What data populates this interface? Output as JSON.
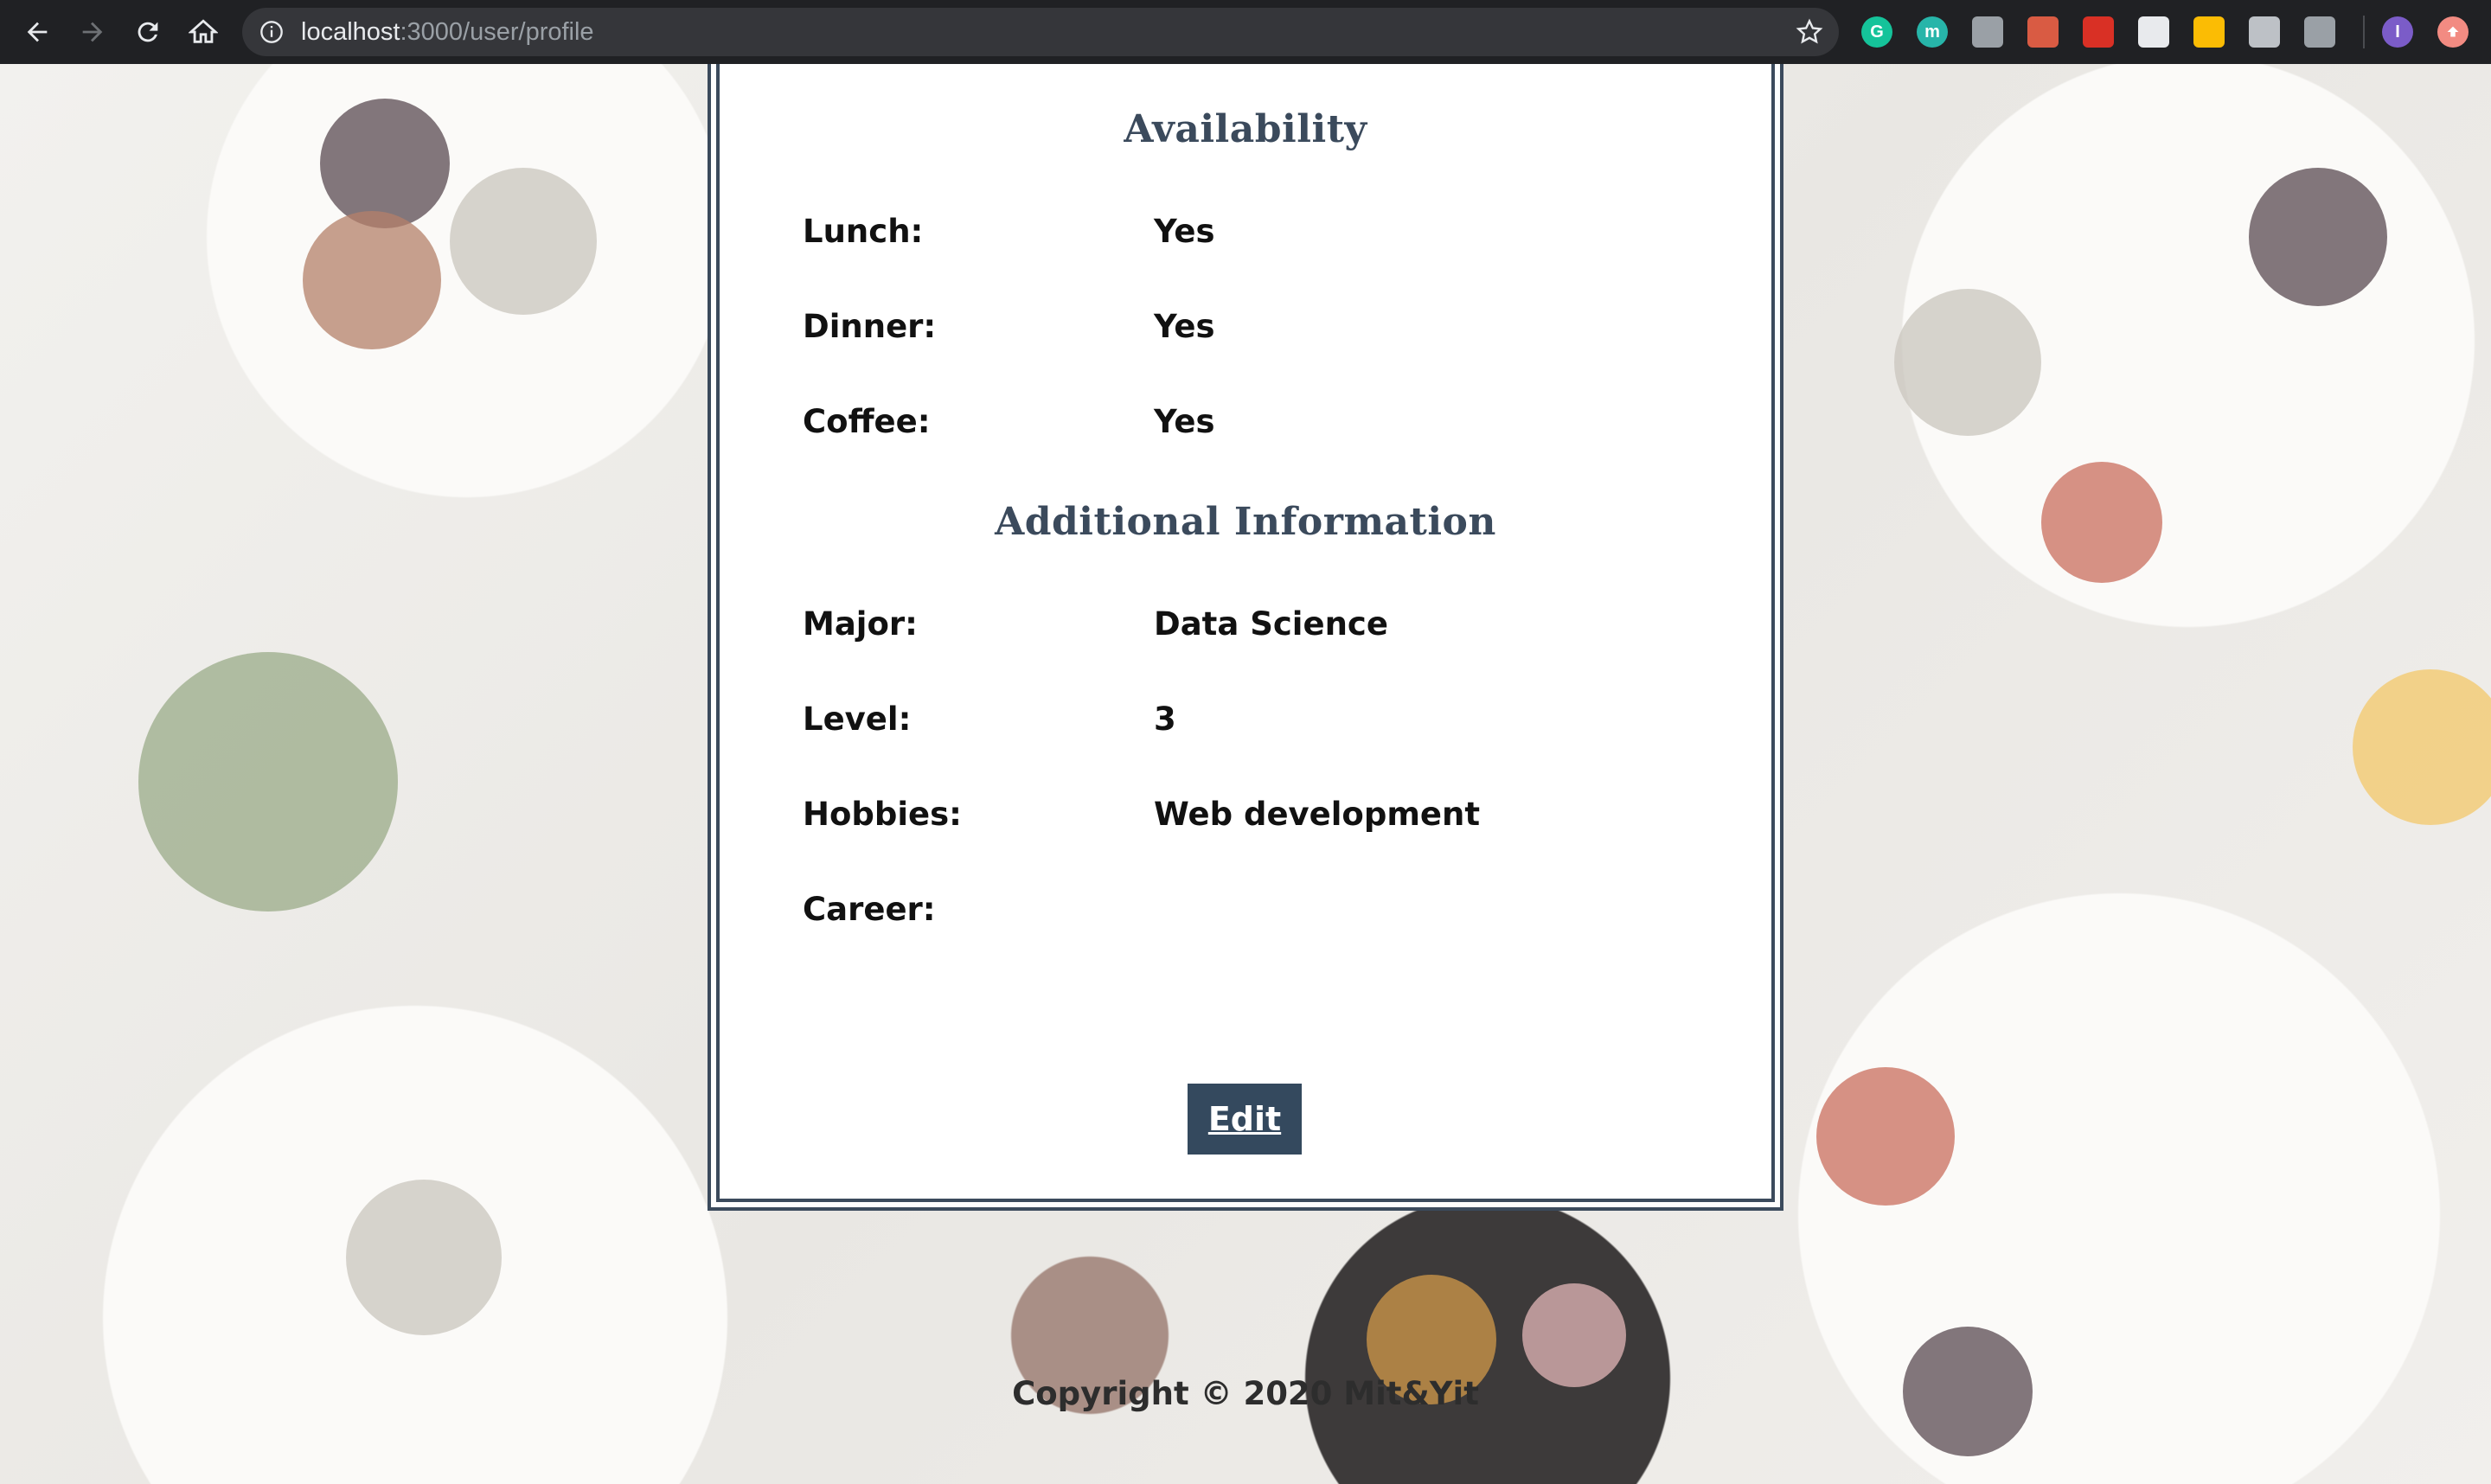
{
  "browser": {
    "url_host": "localhost",
    "url_path": ":3000/user/profile",
    "extensions": [
      {
        "name": "grammarly-extension-icon",
        "letter": "G",
        "color": "#15c39a"
      },
      {
        "name": "extension-icon-m",
        "letter": "m",
        "color": "#27b5a9"
      },
      {
        "name": "extension-icon-bulb",
        "letter": "",
        "color": "#9aa0a6"
      },
      {
        "name": "extension-icon-doc",
        "letter": "",
        "color": "#d95b43"
      },
      {
        "name": "extension-icon-red",
        "letter": "",
        "color": "#d93025"
      },
      {
        "name": "extension-icon-gauge",
        "letter": "",
        "color": "#e8eaed"
      },
      {
        "name": "extension-icon-stack",
        "letter": "",
        "color": "#fbbc04"
      },
      {
        "name": "extension-icon-chat",
        "letter": "",
        "color": "#bdc1c6"
      },
      {
        "name": "extension-icon-drive",
        "letter": "",
        "color": "#9aa0a6"
      }
    ],
    "profile_letter": "I",
    "profile_color": "#7b5cc8",
    "menu_color": "#f28b82"
  },
  "availability": {
    "title": "Availability",
    "fields": [
      {
        "label": "Lunch:",
        "value": "Yes"
      },
      {
        "label": "Dinner:",
        "value": "Yes"
      },
      {
        "label": "Coffee:",
        "value": "Yes"
      }
    ]
  },
  "additional": {
    "title": "Additional Information",
    "fields": [
      {
        "label": "Major:",
        "value": "Data Science"
      },
      {
        "label": "Level:",
        "value": "3"
      },
      {
        "label": "Hobbies:",
        "value": "Web development"
      },
      {
        "label": "Career:",
        "value": ""
      }
    ]
  },
  "edit_label": "Edit",
  "footer": {
    "copyright": "Copyright © 2020 Mit&Yit"
  },
  "colors": {
    "accent": "#34495e",
    "card_border": "#3b4a5c"
  }
}
